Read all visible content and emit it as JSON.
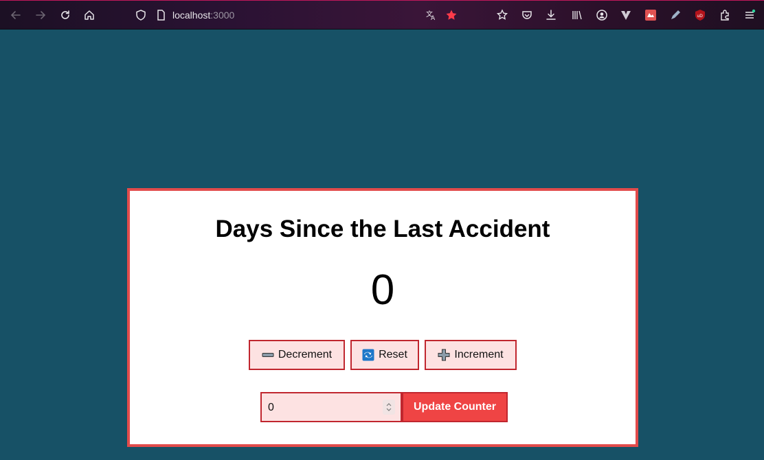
{
  "browser": {
    "url_host": "localhost",
    "url_port": ":3000",
    "icons": [
      "back-arrow-icon",
      "forward-arrow-icon",
      "reload-icon",
      "home-icon",
      "shield-icon",
      "page-icon",
      "translate-icon",
      "bookmark-star-icon",
      "pocket-icon",
      "save-to-pocket-icon",
      "downloads-icon",
      "library-icon",
      "account-icon",
      "vivaldi-icon",
      "extension-red-icon",
      "pen-icon",
      "ublock-icon",
      "extensions-icon",
      "menu-icon"
    ],
    "accent_color": "#e24b4b"
  },
  "app": {
    "title": "Days Since the Last Accident",
    "counter": "0",
    "buttons": {
      "decrement": "Decrement",
      "reset": "Reset",
      "increment": "Increment"
    },
    "input_value": "0",
    "update_label": "Update Counter"
  },
  "colors": {
    "page_background": "#175166",
    "card_border": "#e24b4b",
    "button_fill": "#fde2e2",
    "button_border": "#c0262e",
    "update_button": "#ef4444"
  }
}
